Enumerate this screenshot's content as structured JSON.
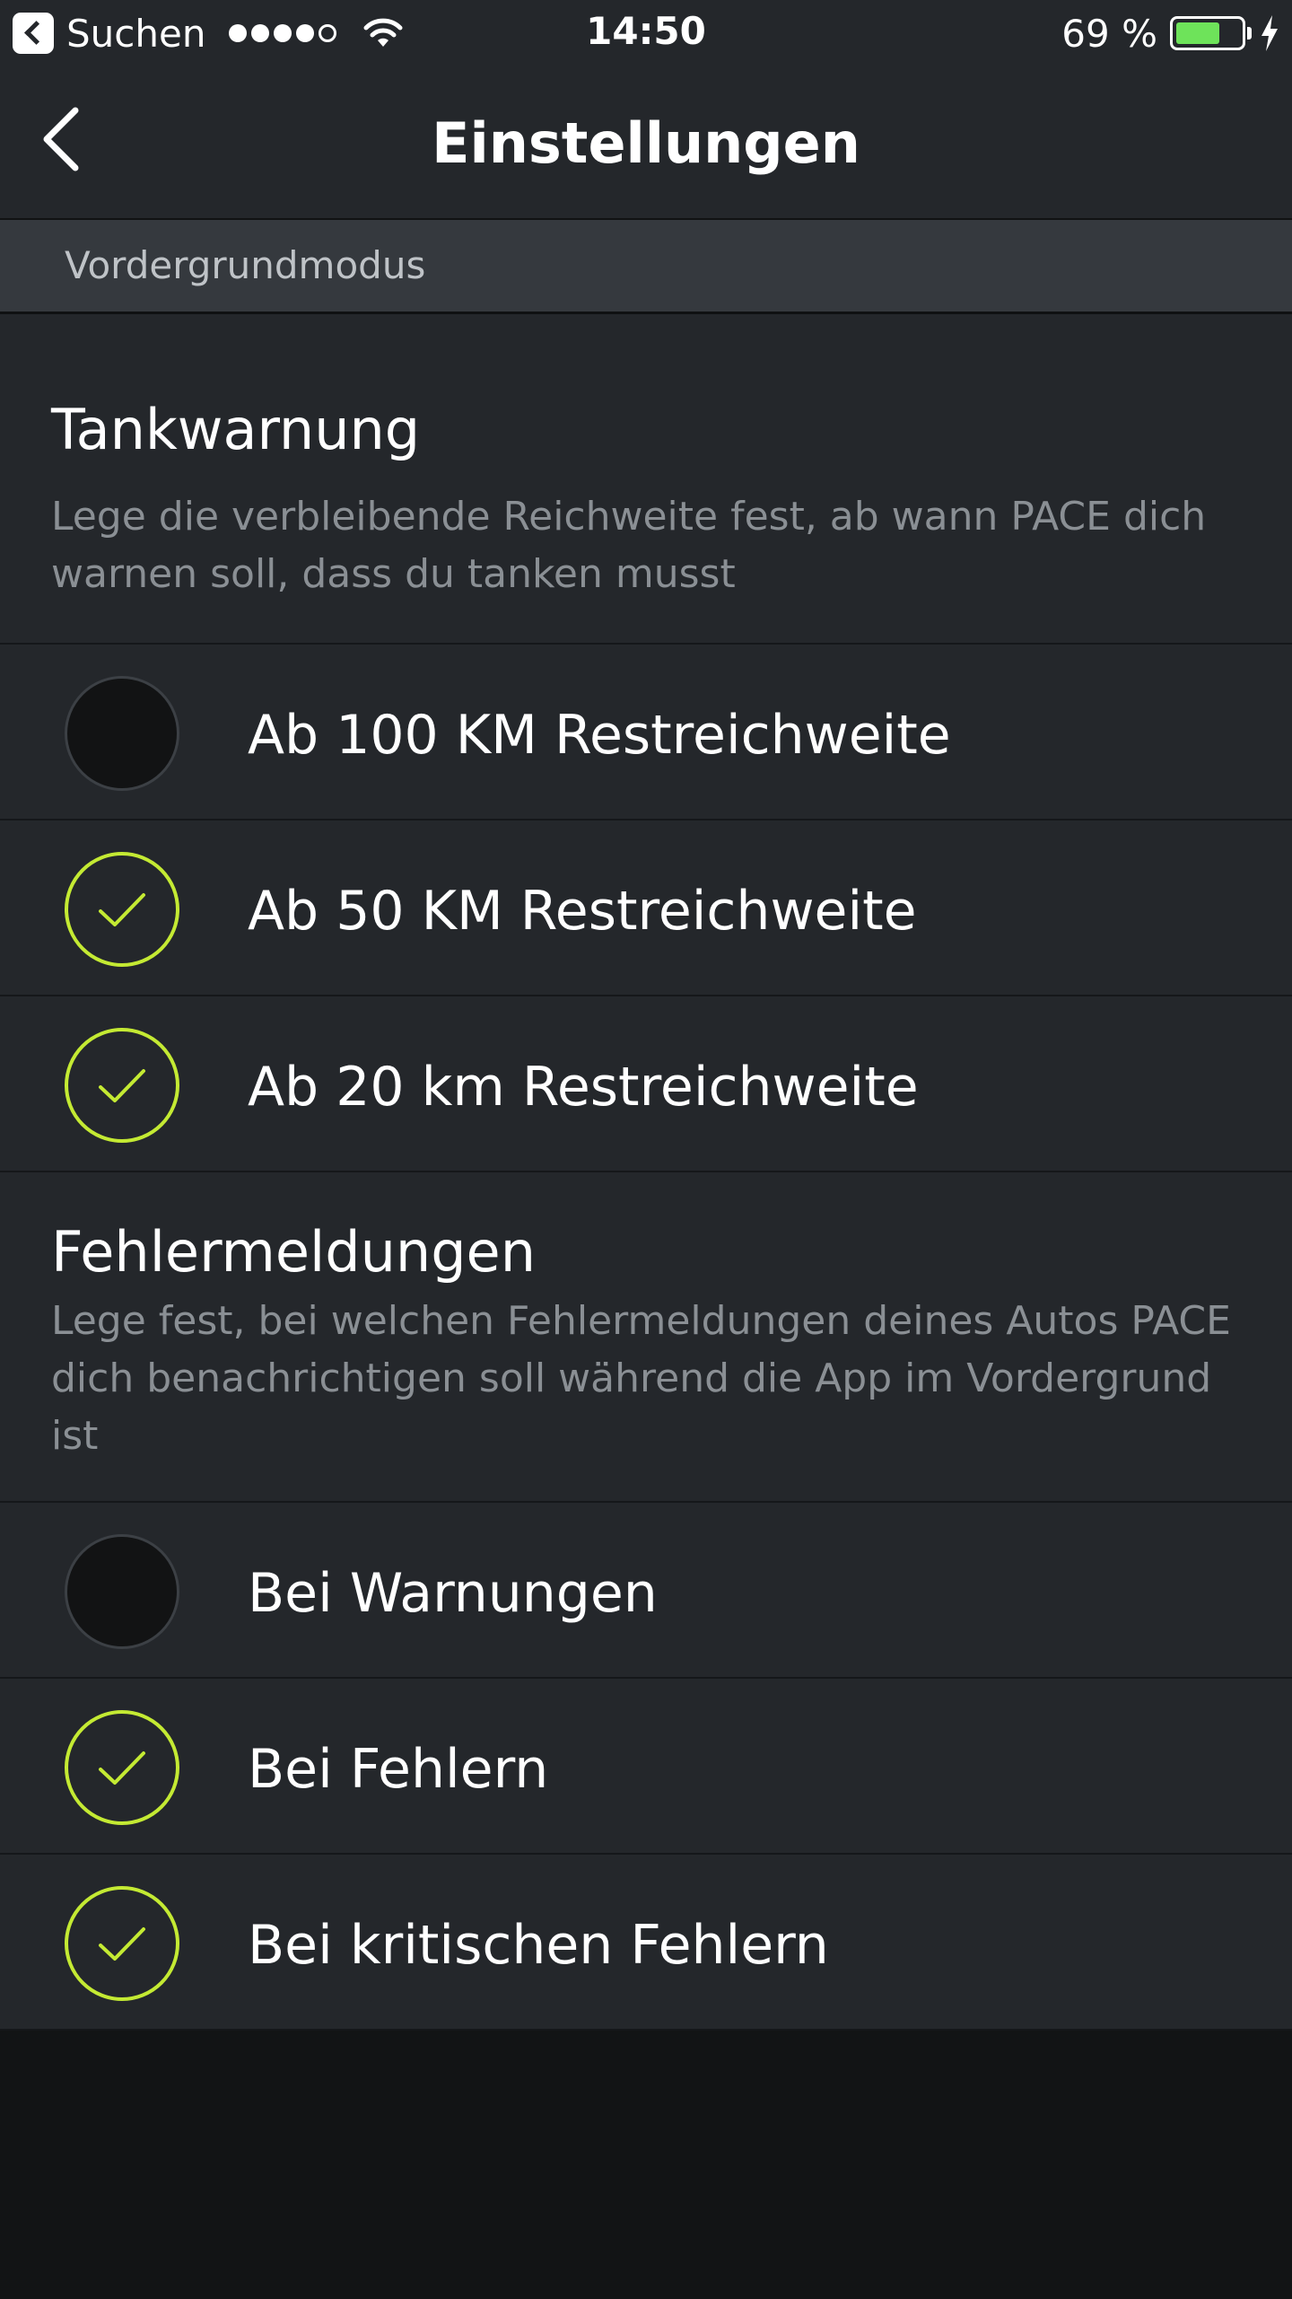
{
  "status_bar": {
    "back_app_label": "Suchen",
    "time": "14:50",
    "battery_percent_text": "69 %",
    "battery_level": 0.69,
    "signal_bars_filled": 4,
    "signal_bars_total": 5,
    "battery_fill_color": "#6ee35a"
  },
  "nav": {
    "title": "Einstellungen",
    "back_icon": "chevron-left-icon"
  },
  "section": {
    "label": "Vordergrundmodus"
  },
  "groups": [
    {
      "title": "Tankwarnung",
      "description": "Lege die verbleibende Reichweite fest, ab wann PACE dich warnen soll, dass du tanken musst",
      "options": [
        {
          "label": "Ab 100 KM Restreichweite",
          "checked": false
        },
        {
          "label": "Ab 50 KM Restreichweite",
          "checked": true
        },
        {
          "label": "Ab 20 km Restreichweite",
          "checked": true
        }
      ]
    },
    {
      "title": "Fehlermeldungen",
      "description": "Lege fest, bei welchen Fehlermeldungen deines Autos PACE dich benachrichtigen soll während die App im Vordergrund ist",
      "options": [
        {
          "label": "Bei Warnungen",
          "checked": false
        },
        {
          "label": "Bei Fehlern",
          "checked": true
        },
        {
          "label": "Bei kritischen Fehlern",
          "checked": true
        }
      ]
    }
  ],
  "colors": {
    "accent": "#c4ea33",
    "background": "#24272b",
    "section_header": "#35393e",
    "description_text": "#8a8f94"
  }
}
